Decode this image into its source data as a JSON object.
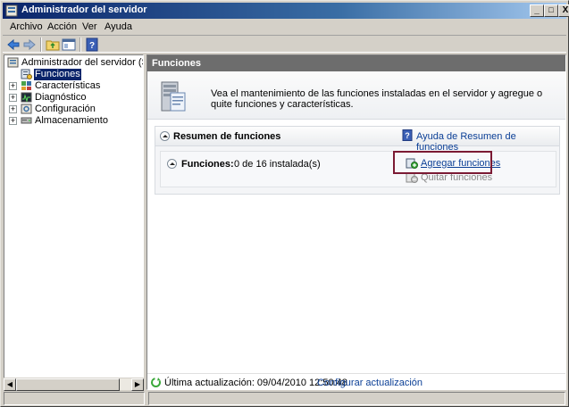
{
  "window": {
    "title": "Administrador del servidor",
    "controls": {
      "minimize": "_",
      "maximize": "□",
      "close": "X"
    }
  },
  "menubar": {
    "items": [
      "Archivo",
      "Acción",
      "Ver",
      "Ayuda"
    ]
  },
  "toolbar": {
    "icons": [
      "back-arrow-icon",
      "forward-arrow-icon",
      "up-folder-icon",
      "show-hide-tree-icon",
      "help-icon"
    ]
  },
  "tree": {
    "root": {
      "label": "Administrador del servidor (SERVID",
      "icon": "server-manager-icon"
    },
    "items": [
      {
        "label": "Funciones",
        "icon": "roles-icon",
        "selected": true,
        "expandable": false
      },
      {
        "label": "Características",
        "icon": "features-icon",
        "selected": false,
        "expandable": true
      },
      {
        "label": "Diagnóstico",
        "icon": "diagnostics-icon",
        "selected": false,
        "expandable": true
      },
      {
        "label": "Configuración",
        "icon": "configuration-icon",
        "selected": false,
        "expandable": true
      },
      {
        "label": "Almacenamiento",
        "icon": "storage-icon",
        "selected": false,
        "expandable": true
      }
    ]
  },
  "main": {
    "header": "Funciones",
    "intro": "Vea el mantenimiento de las funciones instaladas en el servidor y agregue o quite funciones y características.",
    "summary": {
      "title": "Resumen de funciones",
      "help_link": "Ayuda de Resumen de funciones",
      "roles_label": "Funciones:",
      "roles_count": "0 de 16 instalada(s)",
      "actions": [
        {
          "label": "Agregar funciones",
          "enabled": true,
          "icon": "add-roles-icon"
        },
        {
          "label": "Quitar funciones",
          "enabled": false,
          "icon": "remove-roles-icon"
        }
      ]
    },
    "status": {
      "last_update": "Última actualización: 09/04/2010 12:50:48",
      "configure_link": "Configurar actualización"
    }
  },
  "colors": {
    "accent": "#0a246a",
    "link": "#0b3f96",
    "header_bg": "#6d6d6d",
    "highlight_border": "#7b1a33"
  }
}
